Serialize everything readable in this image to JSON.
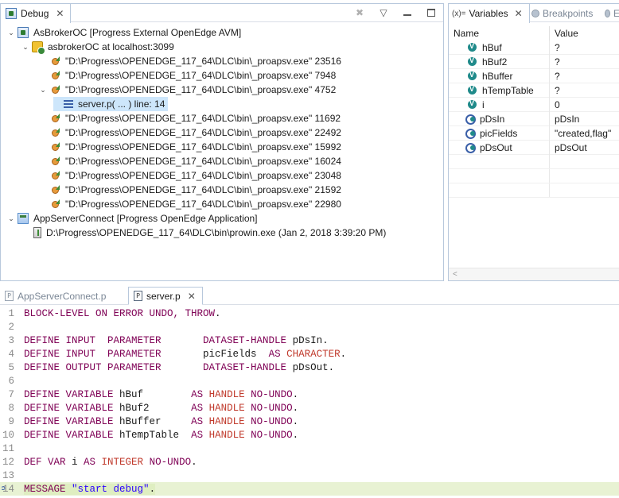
{
  "debug_view": {
    "tab_label": "Debug",
    "tree": [
      {
        "text": "AsBrokerOC [Progress External OpenEdge AVM]",
        "level": 0,
        "twisty": "open",
        "icon": "debug-launch-icon"
      },
      {
        "text": "asbrokerOC at localhost:3099",
        "level": 1,
        "twisty": "open",
        "icon": "debug-target-icon"
      },
      {
        "text": "\"D:\\Progress\\OPENEDGE_117_64\\DLC\\bin\\_proapsv.exe\" 23516",
        "level": 2,
        "twisty": "none",
        "icon": "thread-running-icon"
      },
      {
        "text": "\"D:\\Progress\\OPENEDGE_117_64\\DLC\\bin\\_proapsv.exe\" 7948",
        "level": 2,
        "twisty": "none",
        "icon": "thread-running-icon"
      },
      {
        "text": "\"D:\\Progress\\OPENEDGE_117_64\\DLC\\bin\\_proapsv.exe\" 4752",
        "level": 2,
        "twisty": "open",
        "icon": "thread-suspended-icon"
      },
      {
        "text": "server.p( ... ) line: 14",
        "level": 3,
        "twisty": "none",
        "icon": "stack-frame-icon",
        "selected": true
      },
      {
        "text": "\"D:\\Progress\\OPENEDGE_117_64\\DLC\\bin\\_proapsv.exe\" 11692",
        "level": 2,
        "twisty": "none",
        "icon": "thread-running-icon"
      },
      {
        "text": "\"D:\\Progress\\OPENEDGE_117_64\\DLC\\bin\\_proapsv.exe\" 22492",
        "level": 2,
        "twisty": "none",
        "icon": "thread-running-icon"
      },
      {
        "text": "\"D:\\Progress\\OPENEDGE_117_64\\DLC\\bin\\_proapsv.exe\" 15992",
        "level": 2,
        "twisty": "none",
        "icon": "thread-running-icon"
      },
      {
        "text": "\"D:\\Progress\\OPENEDGE_117_64\\DLC\\bin\\_proapsv.exe\" 16024",
        "level": 2,
        "twisty": "none",
        "icon": "thread-running-icon"
      },
      {
        "text": "\"D:\\Progress\\OPENEDGE_117_64\\DLC\\bin\\_proapsv.exe\" 23048",
        "level": 2,
        "twisty": "none",
        "icon": "thread-running-icon"
      },
      {
        "text": "\"D:\\Progress\\OPENEDGE_117_64\\DLC\\bin\\_proapsv.exe\" 21592",
        "level": 2,
        "twisty": "none",
        "icon": "thread-running-icon"
      },
      {
        "text": "\"D:\\Progress\\OPENEDGE_117_64\\DLC\\bin\\_proapsv.exe\" 22980",
        "level": 2,
        "twisty": "none",
        "icon": "thread-running-icon"
      },
      {
        "text": "AppServerConnect [Progress OpenEdge Application]",
        "level": 0,
        "twisty": "open",
        "icon": "app-launch-icon"
      },
      {
        "text": "D:\\Progress\\OPENEDGE_117_64\\DLC\\bin\\prowin.exe (Jan 2, 2018 3:39:20 PM)",
        "level": 1,
        "twisty": "none",
        "icon": "process-icon"
      }
    ]
  },
  "variables_view": {
    "tab_prefix": "(x)=",
    "tab_label": "Variables",
    "breakpoints_label": "Breakpoints",
    "third_tab_label": "E",
    "columns": {
      "name": "Name",
      "value": "Value"
    },
    "rows": [
      {
        "name": "hBuf",
        "value": "?",
        "icon": "variable-icon"
      },
      {
        "name": "hBuf2",
        "value": "?",
        "icon": "variable-icon"
      },
      {
        "name": "hBuffer",
        "value": "?",
        "icon": "variable-icon"
      },
      {
        "name": "hTempTable",
        "value": "?",
        "icon": "variable-icon"
      },
      {
        "name": "i",
        "value": "0",
        "icon": "variable-icon"
      },
      {
        "name": "pDsIn",
        "value": "pDsIn",
        "icon": "parameter-icon"
      },
      {
        "name": "picFields",
        "value": "\"created,flag\"",
        "icon": "parameter-icon"
      },
      {
        "name": "pDsOut",
        "value": "pDsOut",
        "icon": "parameter-icon"
      }
    ],
    "scroll_left": "<"
  },
  "editor": {
    "tabs": [
      {
        "label": "AppServerConnect.p",
        "active": false
      },
      {
        "label": "server.p",
        "active": true
      }
    ],
    "current_line": 14,
    "lines": [
      {
        "n": "1",
        "tokens": [
          {
            "t": "kw",
            "v": "BLOCK-LEVEL ON ERROR UNDO, THROW"
          },
          {
            "t": "",
            "v": "."
          }
        ]
      },
      {
        "n": "2",
        "tokens": []
      },
      {
        "n": "3",
        "tokens": [
          {
            "t": "kw",
            "v": "DEFINE INPUT  PARAMETER       DATASET-HANDLE"
          },
          {
            "t": "",
            "v": " pDsIn."
          }
        ]
      },
      {
        "n": "4",
        "tokens": [
          {
            "t": "kw",
            "v": "DEFINE INPUT  PARAMETER"
          },
          {
            "t": "",
            "v": "       picFields  "
          },
          {
            "t": "kw",
            "v": "AS "
          },
          {
            "t": "ty",
            "v": "CHARACTER"
          },
          {
            "t": "",
            "v": "."
          }
        ]
      },
      {
        "n": "5",
        "tokens": [
          {
            "t": "kw",
            "v": "DEFINE OUTPUT PARAMETER       DATASET-HANDLE"
          },
          {
            "t": "",
            "v": " pDsOut."
          }
        ]
      },
      {
        "n": "6",
        "tokens": []
      },
      {
        "n": "7",
        "tokens": [
          {
            "t": "kw",
            "v": "DEFINE VARIABLE"
          },
          {
            "t": "",
            "v": " hBuf        "
          },
          {
            "t": "kw",
            "v": "AS "
          },
          {
            "t": "ty",
            "v": "HANDLE"
          },
          {
            "t": "kw",
            "v": " NO-UNDO"
          },
          {
            "t": "",
            "v": "."
          }
        ]
      },
      {
        "n": "8",
        "tokens": [
          {
            "t": "kw",
            "v": "DEFINE VARIABLE"
          },
          {
            "t": "",
            "v": " hBuf2       "
          },
          {
            "t": "kw",
            "v": "AS "
          },
          {
            "t": "ty",
            "v": "HANDLE"
          },
          {
            "t": "kw",
            "v": " NO-UNDO"
          },
          {
            "t": "",
            "v": "."
          }
        ]
      },
      {
        "n": "9",
        "tokens": [
          {
            "t": "kw",
            "v": "DEFINE VARIABLE"
          },
          {
            "t": "",
            "v": " hBuffer     "
          },
          {
            "t": "kw",
            "v": "AS "
          },
          {
            "t": "ty",
            "v": "HANDLE"
          },
          {
            "t": "kw",
            "v": " NO-UNDO"
          },
          {
            "t": "",
            "v": "."
          }
        ]
      },
      {
        "n": "10",
        "tokens": [
          {
            "t": "kw",
            "v": "DEFINE VARIABLE"
          },
          {
            "t": "",
            "v": " hTempTable  "
          },
          {
            "t": "kw",
            "v": "AS "
          },
          {
            "t": "ty",
            "v": "HANDLE"
          },
          {
            "t": "kw",
            "v": " NO-UNDO"
          },
          {
            "t": "",
            "v": "."
          }
        ]
      },
      {
        "n": "11",
        "tokens": []
      },
      {
        "n": "12",
        "tokens": [
          {
            "t": "kw",
            "v": "DEF VAR"
          },
          {
            "t": "",
            "v": " i "
          },
          {
            "t": "kw",
            "v": "AS "
          },
          {
            "t": "ty",
            "v": "INTEGER"
          },
          {
            "t": "kw",
            "v": " NO-UNDO"
          },
          {
            "t": "",
            "v": "."
          }
        ]
      },
      {
        "n": "13",
        "tokens": []
      },
      {
        "n": "14",
        "tokens": [
          {
            "t": "kw",
            "v": "MESSAGE"
          },
          {
            "t": "",
            "v": " "
          },
          {
            "t": "str",
            "v": "\"start debug\""
          },
          {
            "t": "",
            "v": "."
          }
        ]
      }
    ]
  }
}
